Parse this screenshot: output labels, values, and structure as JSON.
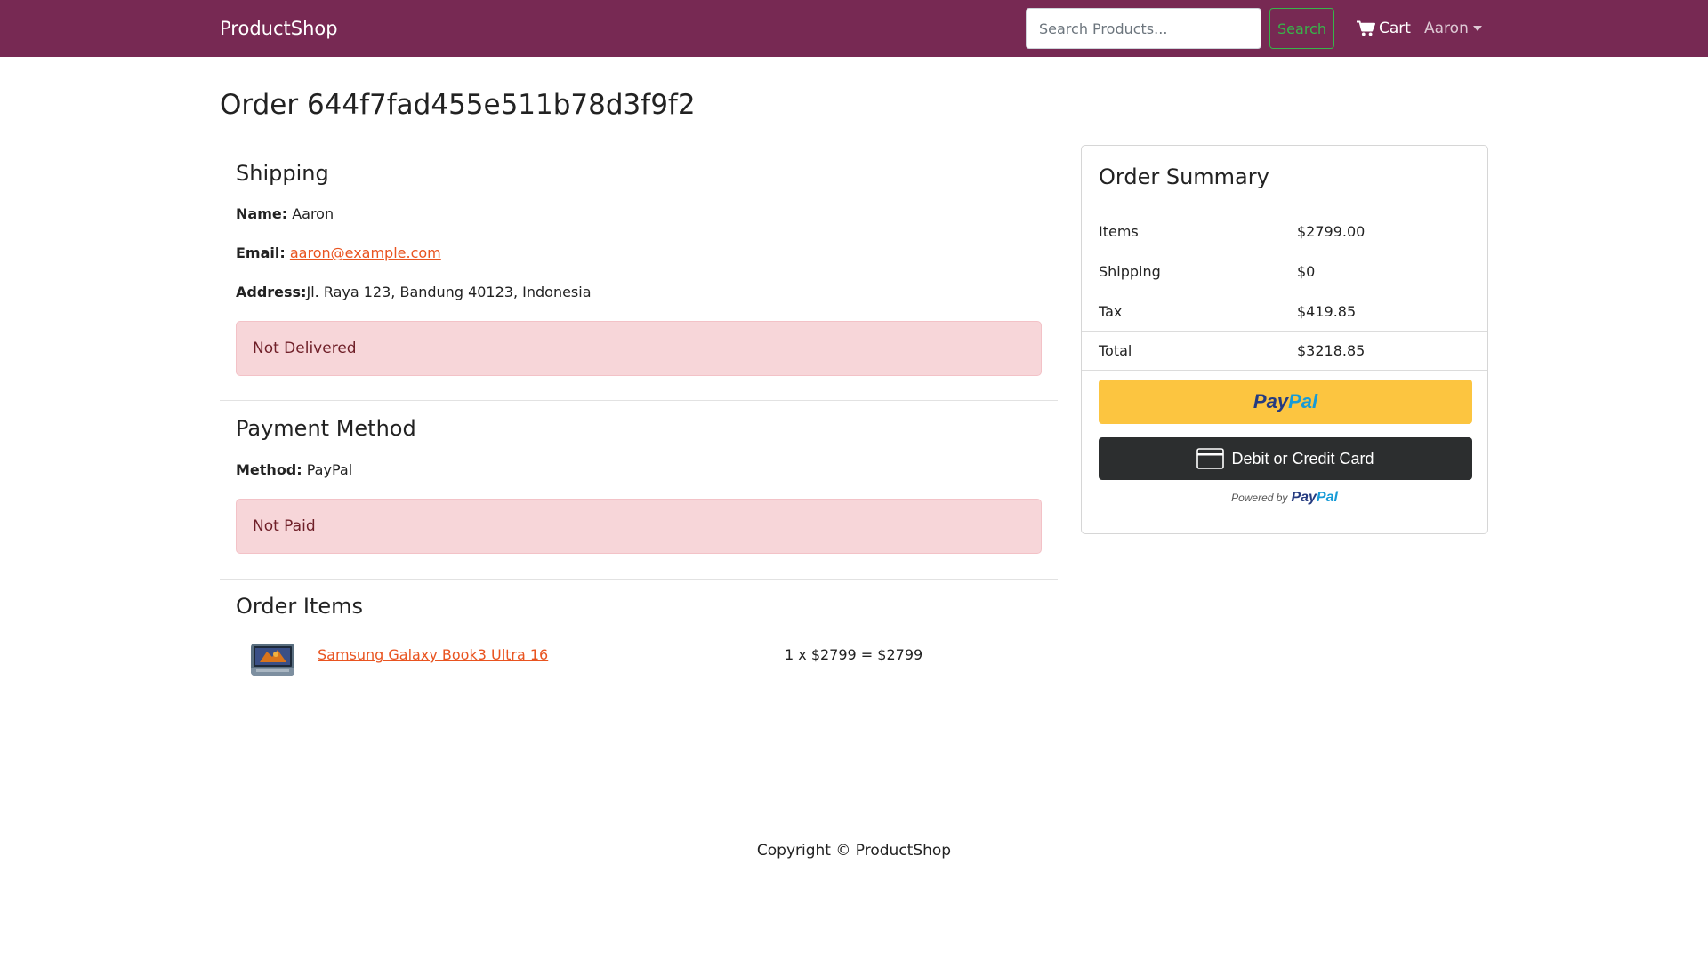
{
  "navbar": {
    "brand": "ProductShop",
    "search": {
      "placeholder": "Search Products...",
      "value": ""
    },
    "search_button_label": "Search",
    "cart_label": "Cart",
    "user_menu_label": "Aaron"
  },
  "order": {
    "title": "Order 644f7fad455e511b78d3f9f2"
  },
  "shipping": {
    "heading": "Shipping",
    "name_label": "Name:",
    "name_value": "Aaron",
    "email_label": "Email:",
    "email_value": "aaron@example.com",
    "address_label": "Address:",
    "address_value": "Jl. Raya 123, Bandung 40123, Indonesia",
    "status": "Not Delivered"
  },
  "payment": {
    "heading": "Payment Method",
    "method_label": "Method:",
    "method_value": "PayPal",
    "status": "Not Paid"
  },
  "order_items": {
    "heading": "Order Items",
    "items": [
      {
        "name": "Samsung Galaxy Book3 Ultra 16",
        "line_total": "1 x $2799 = $2799"
      }
    ]
  },
  "summary": {
    "title": "Order Summary",
    "rows": [
      {
        "label": "Items",
        "value": "$2799.00"
      },
      {
        "label": "Shipping",
        "value": "$0"
      },
      {
        "label": "Tax",
        "value": "$419.85"
      },
      {
        "label": "Total",
        "value": "$3218.85"
      }
    ],
    "paypal_logo_part1": "Pay",
    "paypal_logo_part2": "Pal",
    "card_button_label": "Debit or Credit Card",
    "powered_by_text": "Powered by"
  },
  "footer": {
    "copyright": "Copyright © ProductShop"
  },
  "colors": {
    "navbar_bg": "#772953",
    "accent_link": "#e95420",
    "search_button": "#38b44a",
    "alert_bg": "#f7d6d9",
    "alert_text": "#6f1f28",
    "paypal_yellow": "#fcc540",
    "paypal_dark_blue": "#253b80",
    "paypal_light_blue": "#179bd7",
    "card_button_bg": "#2c2e2f"
  },
  "icons": {
    "cart": "shopping-cart-icon",
    "user_caret": "caret-down-icon",
    "card": "credit-card-icon"
  }
}
